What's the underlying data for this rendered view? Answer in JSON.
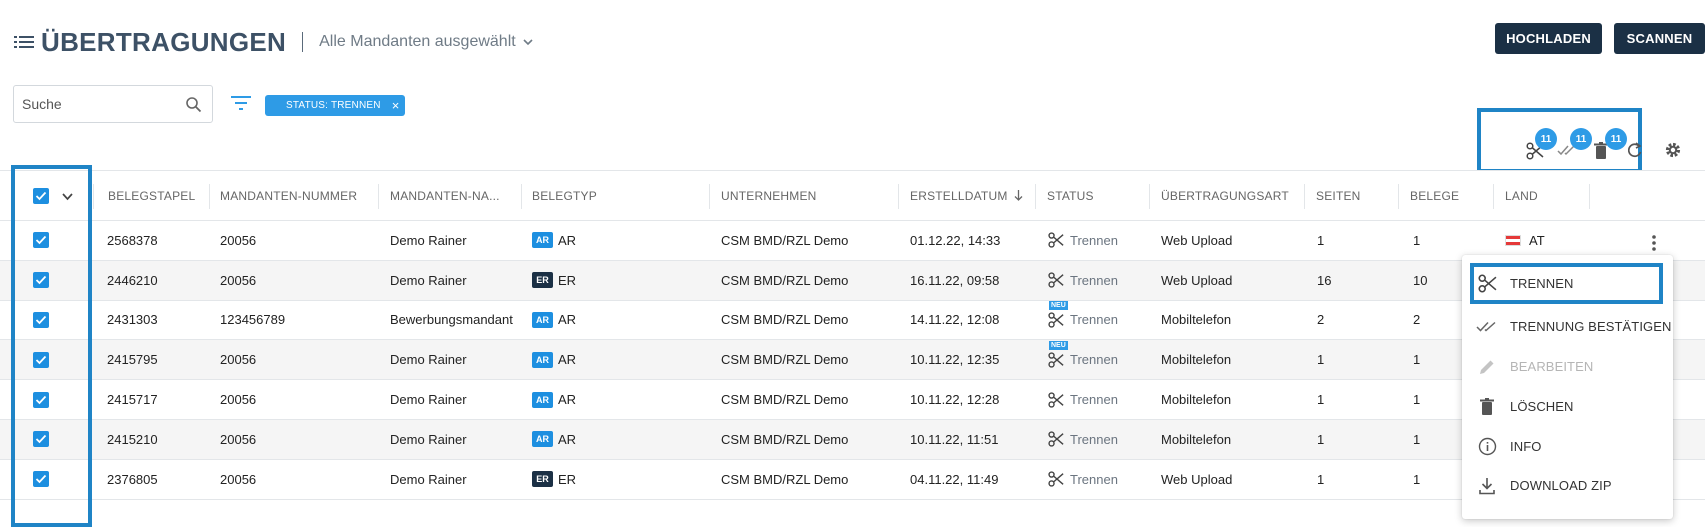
{
  "header": {
    "title": "ÜBERTRAGUNGEN",
    "mandant_select": "Alle Mandanten ausgewählt",
    "upload_label": "HOCHLADEN",
    "scan_label": "SCANNEN"
  },
  "search": {
    "placeholder": "Suche",
    "value": ""
  },
  "filter_chip": {
    "label": "STATUS: TRENNEN",
    "remove": "×"
  },
  "toolbar": {
    "split_count": "11",
    "confirm_count": "11",
    "delete_count": "11"
  },
  "table": {
    "headers": [
      "BELEGSTAPEL",
      "MANDANTEN-NUMMER",
      "MANDANTEN-NA...",
      "BELEGTYP",
      "UNTERNEHMEN",
      "ERSTELLDATUM",
      "STATUS",
      "ÜBERTRAGUNGSART",
      "SEITEN",
      "BELEGE",
      "LAND"
    ],
    "rows": [
      {
        "stapel": "2568378",
        "nummer": "20056",
        "name": "Demo Rainer",
        "typ_tag": "AR",
        "typ": "AR",
        "unternehmen": "CSM BMD/RZL Demo",
        "datum": "01.12.22, 14:33",
        "status": "Trennen",
        "neu": "",
        "art": "Web Upload",
        "seiten": "1",
        "belege": "1",
        "land": "AT"
      },
      {
        "stapel": "2446210",
        "nummer": "20056",
        "name": "Demo Rainer",
        "typ_tag": "ER",
        "typ": "ER",
        "unternehmen": "CSM BMD/RZL Demo",
        "datum": "16.11.22, 09:58",
        "status": "Trennen",
        "neu": "",
        "art": "Web Upload",
        "seiten": "16",
        "belege": "10",
        "land": ""
      },
      {
        "stapel": "2431303",
        "nummer": "123456789",
        "name": "Bewerbungsmandant",
        "typ_tag": "AR",
        "typ": "AR",
        "unternehmen": "CSM BMD/RZL Demo",
        "datum": "14.11.22, 12:08",
        "status": "Trennen",
        "neu": "NEU",
        "art": "Mobiltelefon",
        "seiten": "2",
        "belege": "2",
        "land": ""
      },
      {
        "stapel": "2415795",
        "nummer": "20056",
        "name": "Demo Rainer",
        "typ_tag": "AR",
        "typ": "AR",
        "unternehmen": "CSM BMD/RZL Demo",
        "datum": "10.11.22, 12:35",
        "status": "Trennen",
        "neu": "NEU",
        "art": "Mobiltelefon",
        "seiten": "1",
        "belege": "1",
        "land": ""
      },
      {
        "stapel": "2415717",
        "nummer": "20056",
        "name": "Demo Rainer",
        "typ_tag": "AR",
        "typ": "AR",
        "unternehmen": "CSM BMD/RZL Demo",
        "datum": "10.11.22, 12:28",
        "status": "Trennen",
        "neu": "",
        "art": "Mobiltelefon",
        "seiten": "1",
        "belege": "1",
        "land": ""
      },
      {
        "stapel": "2415210",
        "nummer": "20056",
        "name": "Demo Rainer",
        "typ_tag": "AR",
        "typ": "AR",
        "unternehmen": "CSM BMD/RZL Demo",
        "datum": "10.11.22, 11:51",
        "status": "Trennen",
        "neu": "",
        "art": "Mobiltelefon",
        "seiten": "1",
        "belege": "1",
        "land": ""
      },
      {
        "stapel": "2376805",
        "nummer": "20056",
        "name": "Demo Rainer",
        "typ_tag": "ER",
        "typ": "ER",
        "unternehmen": "CSM BMD/RZL Demo",
        "datum": "04.11.22, 11:49",
        "status": "Trennen",
        "neu": "",
        "art": "Web Upload",
        "seiten": "1",
        "belege": "1",
        "land": ""
      }
    ]
  },
  "context_menu": {
    "items": [
      "TRENNEN",
      "TRENNUNG BESTÄTIGEN",
      "BEARBEITEN",
      "LÖSCHEN",
      "INFO",
      "DOWNLOAD ZIP"
    ]
  },
  "colors": {
    "accent": "#1d8fe0",
    "dark": "#1b3045",
    "highlight": "#1f84c6",
    "tag_ar": "#1d8fe0",
    "tag_er": "#1b3045"
  }
}
